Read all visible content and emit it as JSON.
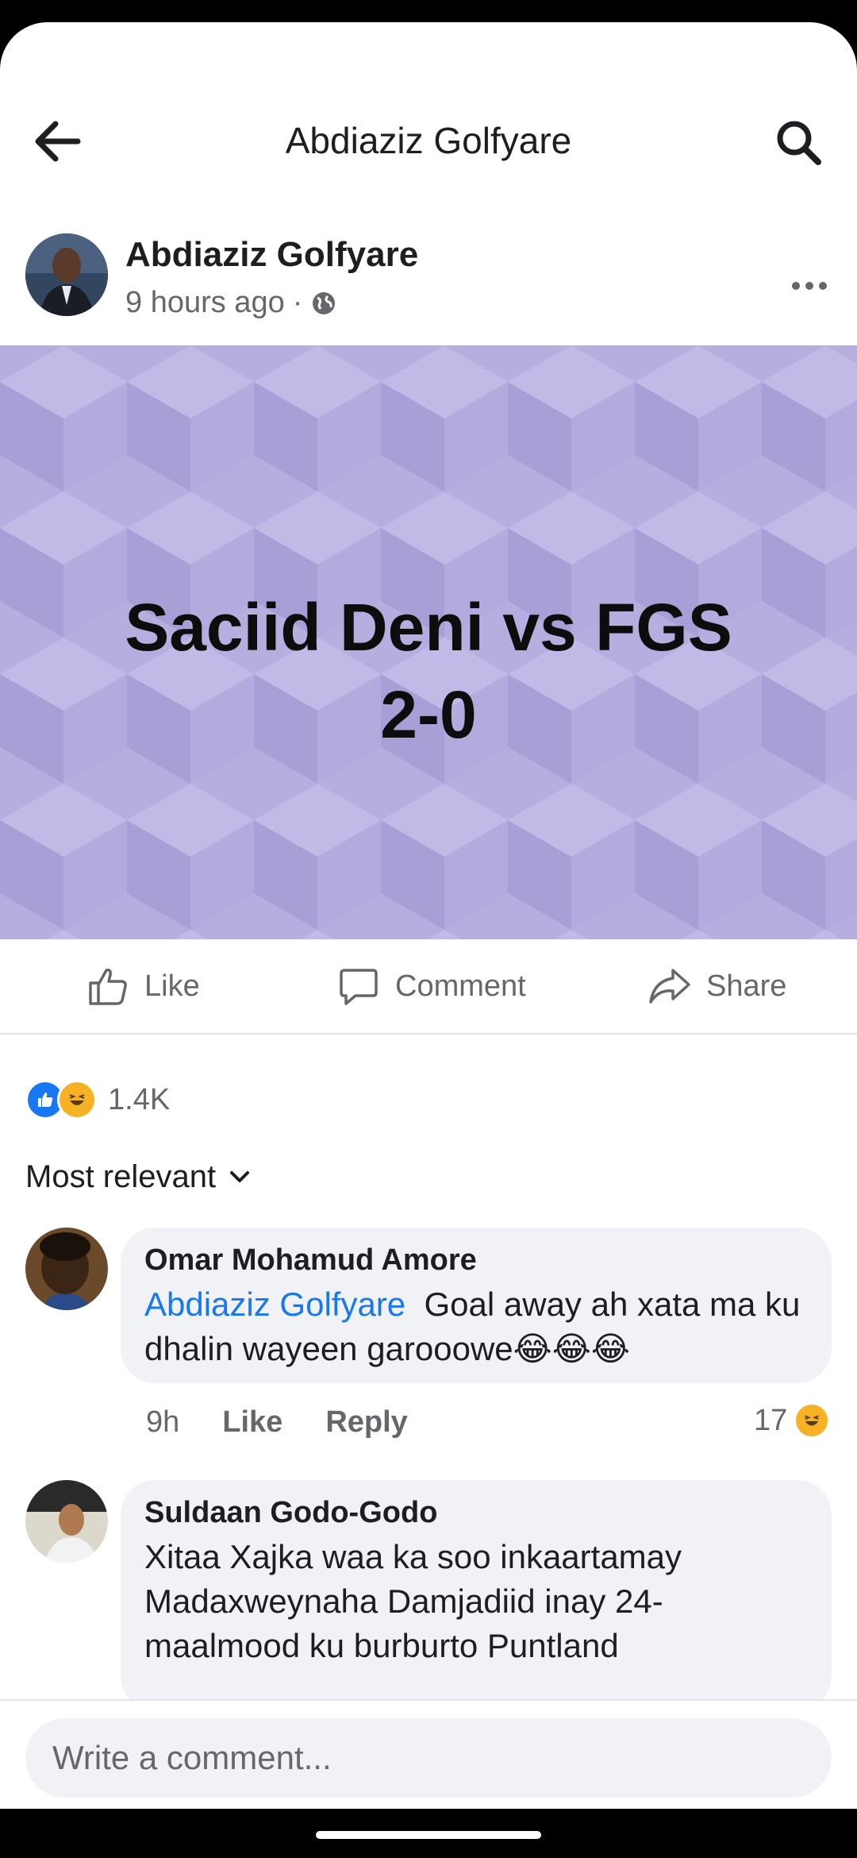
{
  "nav": {
    "title": "Abdiaziz Golfyare",
    "back_icon": "back-arrow-icon",
    "search_icon": "search-icon"
  },
  "post": {
    "author": "Abdiaziz Golfyare",
    "time": "9 hours ago",
    "separator": "·",
    "privacy_icon": "globe-icon",
    "banner_line1": "Saciid Deni vs FGS",
    "banner_line2": "2-0",
    "banner_color": "#b7aee0"
  },
  "actions": {
    "like": "Like",
    "comment": "Comment",
    "share": "Share"
  },
  "reactions": {
    "count": "1.4K",
    "types": [
      "like",
      "haha"
    ]
  },
  "sort": {
    "label": "Most relevant"
  },
  "comments": [
    {
      "name": "Omar Mohamud Amore",
      "mention": "Abdiaziz Golfyare",
      "text": "Goal away ah xata ma ku dhalin wayeen garooowe😂😂😂",
      "time": "9h",
      "like": "Like",
      "reply": "Reply",
      "reaction_count": "17"
    },
    {
      "name": "Suldaan Godo-Godo",
      "text": "Xitaa Xajka waa ka soo inkaartamay Madaxweynaha Damjadiid  inay 24-maalmood ku burburto Puntland"
    }
  ],
  "composer": {
    "placeholder": "Write a comment..."
  },
  "colors": {
    "accent": "#1877f2",
    "secondary_text": "#65676b",
    "bubble": "#f0f2f5"
  }
}
